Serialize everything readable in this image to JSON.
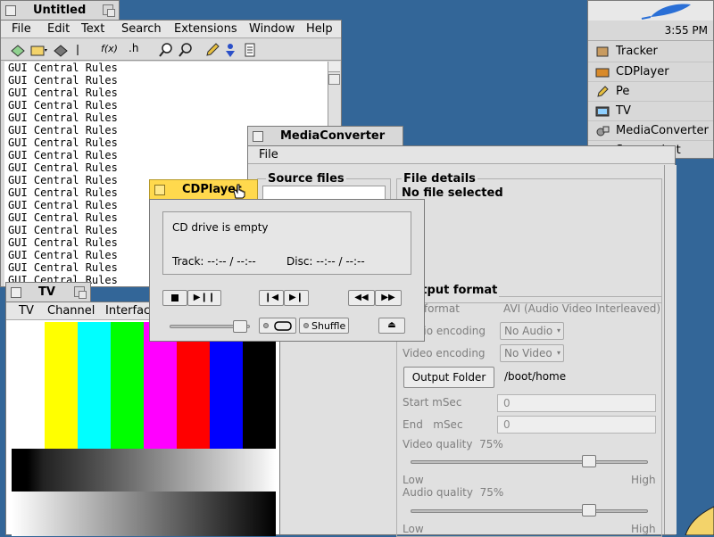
{
  "desktop": {
    "background": "#336698"
  },
  "deskbar": {
    "time": "3:55 PM",
    "items": [
      {
        "label": "Tracker",
        "icon": "tracker-icon"
      },
      {
        "label": "CDPlayer",
        "icon": "cd-icon"
      },
      {
        "label": "Pe",
        "icon": "pe-icon"
      },
      {
        "label": "TV",
        "icon": "tv-icon"
      },
      {
        "label": "MediaConverter",
        "icon": "mediaconverter-icon"
      },
      {
        "label": "Screenshot",
        "icon": "screenshot-icon"
      }
    ]
  },
  "pe_window": {
    "title": "Untitled",
    "menu": [
      "File",
      "Edit",
      "Text",
      "Search",
      "Extensions",
      "Window",
      "Help"
    ],
    "toolbar": {
      "func_label": "f(x)",
      "header_label": ".h"
    },
    "lines": [
      "GUI Central Rules",
      "GUI Central Rules",
      "GUI Central Rules",
      "GUI Central Rules",
      "GUI Central Rules",
      "GUI Central Rules",
      "GUI Central Rules",
      "GUI Central Rules",
      "GUI Central Rules",
      "GUI Central Rules",
      "GUI Central Rules",
      "GUI Central Rules",
      "GUI Central Rules",
      "GUI Central Rules",
      "GUI Central Rules",
      "GUI Central Rules",
      "GUI Central Rules",
      "GUI Central Rules"
    ]
  },
  "mediaconverter": {
    "title": "MediaConverter",
    "menu": [
      "File"
    ],
    "source_files_label": "Source files",
    "file_details_label": "File details",
    "no_file": "No file selected",
    "output_format_label": "Output format",
    "file_format_label": "File format",
    "file_format_value": "AVI (Audio Video Interleaved)",
    "audio_encoding_label": "Audio encoding",
    "audio_encoding_value": "No Audio",
    "video_encoding_label": "Video encoding",
    "video_encoding_value": "No Video",
    "output_folder_button": "Output Folder",
    "output_folder_path": "/boot/home",
    "start_msec_label": "Start mSec",
    "start_msec_value": "0",
    "end_msec_label": "End   mSec",
    "end_msec_value": "0",
    "video_quality_label": "Video quality  75%",
    "video_quality": 0.75,
    "audio_quality_label": "Audio quality  75%",
    "audio_quality": 0.75,
    "low_label": "Low",
    "high_label": "High"
  },
  "cdplayer": {
    "title": "CDPlayer",
    "status": "CD drive is empty",
    "track": "Track: --:-- / --:--",
    "disc": "Disc: --:-- / --:--",
    "shuffle_label": "Shuffle",
    "volume": 0.88
  },
  "tv_window": {
    "title": "TV",
    "menu": [
      "TV",
      "Channel",
      "Interface"
    ],
    "bars": [
      "#ffffff",
      "#ffff00",
      "#00ffff",
      "#00ff00",
      "#ff00ff",
      "#ff0000",
      "#0000ff",
      "#000000"
    ]
  }
}
